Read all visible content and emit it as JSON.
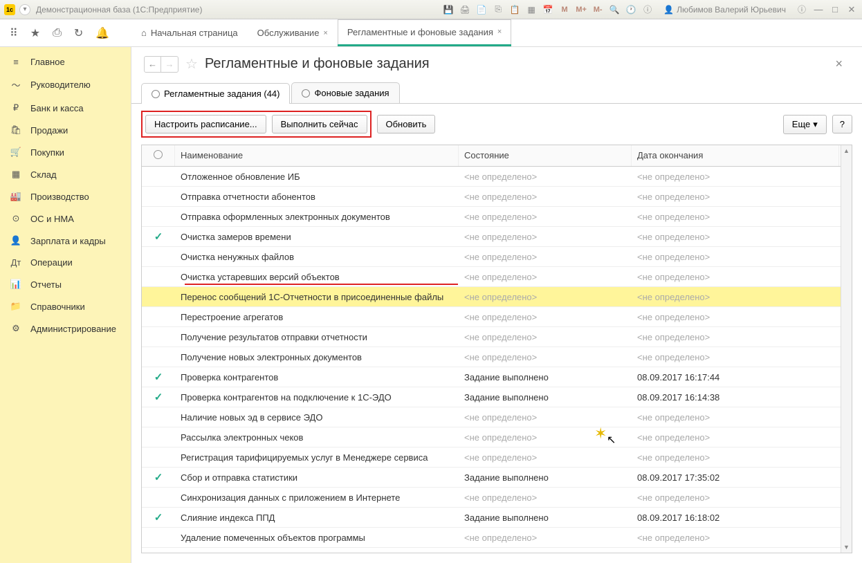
{
  "titlebar": {
    "title": "Демонстрационная база  (1С:Предприятие)",
    "user": "Любимов Валерий Юрьевич",
    "m_labels": [
      "M",
      "M+",
      "M-"
    ]
  },
  "topTabs": [
    {
      "label": "Начальная страница",
      "closable": false,
      "home": true
    },
    {
      "label": "Обслуживание",
      "closable": true
    },
    {
      "label": "Регламентные и фоновые задания",
      "closable": true,
      "active": true
    }
  ],
  "sidebar": [
    {
      "icon": "≡",
      "label": "Главное"
    },
    {
      "icon": "〜",
      "label": "Руководителю"
    },
    {
      "icon": "₽",
      "label": "Банк и касса"
    },
    {
      "icon": "🛍",
      "label": "Продажи"
    },
    {
      "icon": "🛒",
      "label": "Покупки"
    },
    {
      "icon": "▦",
      "label": "Склад"
    },
    {
      "icon": "🏭",
      "label": "Производство"
    },
    {
      "icon": "⊙",
      "label": "ОС и НМА"
    },
    {
      "icon": "👤",
      "label": "Зарплата и кадры"
    },
    {
      "icon": "Дт",
      "label": "Операции"
    },
    {
      "icon": "📊",
      "label": "Отчеты"
    },
    {
      "icon": "📁",
      "label": "Справочники"
    },
    {
      "icon": "⚙",
      "label": "Администрирование"
    }
  ],
  "page": {
    "title": "Регламентные и фоновые задания",
    "subtabs": [
      {
        "label": "Регламентные задания (44)",
        "active": true
      },
      {
        "label": "Фоновые задания"
      }
    ],
    "buttons": {
      "schedule": "Настроить расписание...",
      "runnow": "Выполнить сейчас",
      "refresh": "Обновить",
      "more": "Еще",
      "help": "?"
    },
    "columns": {
      "name": "Наименование",
      "state": "Состояние",
      "date": "Дата окончания"
    },
    "undef": "<не определено>",
    "rows": [
      {
        "check": false,
        "name": "Отложенное обновление ИБ",
        "state": "",
        "date": ""
      },
      {
        "check": false,
        "name": "Отправка отчетности абонентов",
        "state": "",
        "date": ""
      },
      {
        "check": false,
        "name": "Отправка оформленных электронных документов",
        "state": "",
        "date": ""
      },
      {
        "check": true,
        "name": "Очистка замеров времени",
        "state": "",
        "date": ""
      },
      {
        "check": false,
        "name": "Очистка ненужных файлов",
        "state": "",
        "date": ""
      },
      {
        "check": false,
        "name": "Очистка устаревших версий объектов",
        "state": "",
        "date": ""
      },
      {
        "check": false,
        "name": "Перенос сообщений 1С-Отчетности в присоединенные файлы",
        "state": "",
        "date": "",
        "selected": true
      },
      {
        "check": false,
        "name": "Перестроение агрегатов",
        "state": "",
        "date": ""
      },
      {
        "check": false,
        "name": "Получение результатов отправки отчетности",
        "state": "",
        "date": ""
      },
      {
        "check": false,
        "name": "Получение новых электронных документов",
        "state": "",
        "date": ""
      },
      {
        "check": true,
        "name": "Проверка контрагентов",
        "state": "Задание выполнено",
        "date": "08.09.2017 16:17:44"
      },
      {
        "check": true,
        "name": "Проверка контрагентов на подключение к 1С-ЭДО",
        "state": "Задание выполнено",
        "date": "08.09.2017 16:14:38"
      },
      {
        "check": false,
        "name": "Наличие новых эд в сервисе ЭДО",
        "state": "",
        "date": ""
      },
      {
        "check": false,
        "name": "Рассылка электронных чеков",
        "state": "",
        "date": ""
      },
      {
        "check": false,
        "name": "Регистрация тарифицируемых услуг в Менеджере сервиса",
        "state": "",
        "date": ""
      },
      {
        "check": true,
        "name": "Сбор и отправка статистики",
        "state": "Задание выполнено",
        "date": "08.09.2017 17:35:02"
      },
      {
        "check": false,
        "name": "Синхронизация данных с приложением в Интернете",
        "state": "",
        "date": ""
      },
      {
        "check": true,
        "name": "Слияние индекса ППД",
        "state": "Задание выполнено",
        "date": "08.09.2017 16:18:02"
      },
      {
        "check": false,
        "name": "Удаление помеченных объектов программы",
        "state": "",
        "date": ""
      }
    ]
  }
}
